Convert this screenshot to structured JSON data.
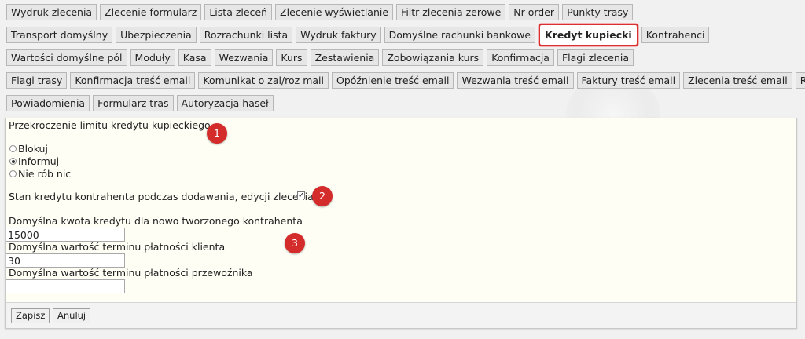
{
  "tabs": {
    "row1": [
      "Wydruk zlecenia",
      "Zlecenie formularz",
      "Lista zleceń",
      "Zlecenie wyświetlanie",
      "Filtr zlecenia zerowe",
      "Nr order",
      "Punkty trasy"
    ],
    "row2": [
      "Transport domyślny",
      "Ubezpieczenia",
      "Rozrachunki lista",
      "Wydruk faktury",
      "Domyślne rachunki bankowe",
      "Kredyt kupiecki",
      "Kontrahenci"
    ],
    "row3": [
      "Wartości domyślne pól",
      "Moduły",
      "Kasa",
      "Wezwania",
      "Kurs",
      "Zestawienia",
      "Zobowiązania kurs",
      "Konfirmacja",
      "Flagi zlecenia"
    ],
    "row4": [
      "Flagi trasy",
      "Konfirmacja treść email",
      "Komunikat o zal/roz mail",
      "Opóźnienie treść email",
      "Wezwania treść email",
      "Faktury treść email",
      "Zlecenia treść email",
      "Raport dla"
    ],
    "row5": [
      "Powiadomienia",
      "Formularz tras",
      "Autoryzacja haseł"
    ],
    "active": "Kredyt kupiecki"
  },
  "form": {
    "limit_label": "Przekroczenie limitu kredytu kupieckiego",
    "options": [
      {
        "label": "Blokuj",
        "checked": false
      },
      {
        "label": "Informuj",
        "checked": true
      },
      {
        "label": "Nie rób nic",
        "checked": false
      }
    ],
    "credit_state_label": "Stan kredytu kontrahenta podczas dodawania, edycji zlecenia",
    "credit_state_checked": true,
    "default_credit_label": "Domyślna kwota kredytu dla nowo tworzonego kontrahenta",
    "default_credit_value": "15000",
    "client_term_label": "Domyślna wartość terminu płatności klienta",
    "client_term_value": "30",
    "carrier_term_label": "Domyślna wartość terminu płatności przewoźnika",
    "carrier_term_value": ""
  },
  "buttons": {
    "save": "Zapisz",
    "cancel": "Anuluj"
  },
  "markers": [
    "1",
    "2",
    "3"
  ],
  "colors": {
    "active_tab_border": "#d93030",
    "marker": "#d42b2b",
    "panel_bg": "#fffef5"
  }
}
